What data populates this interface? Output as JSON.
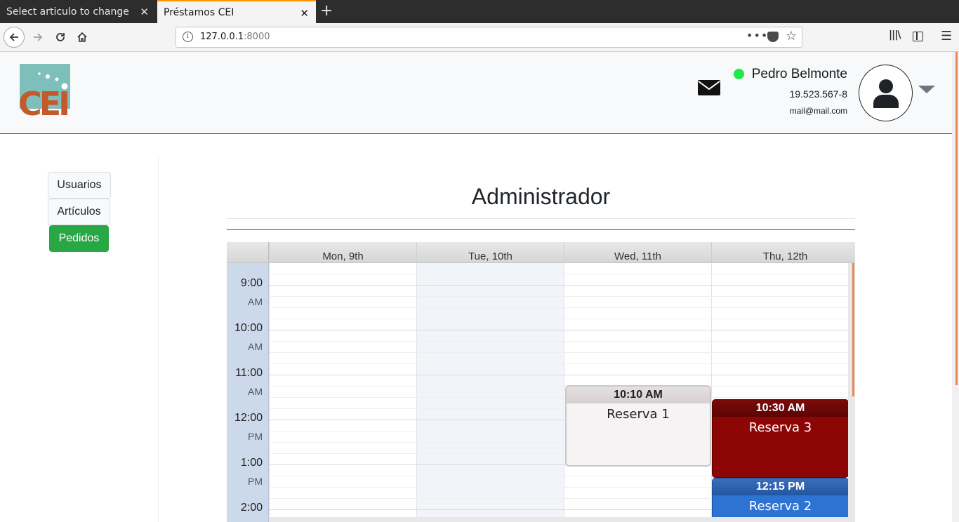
{
  "browser": {
    "tabs": [
      {
        "title": "Select articulo to change | D"
      },
      {
        "title": "Préstamos CEI"
      }
    ],
    "url_host": "127.0.0.1",
    "url_port": ":8000"
  },
  "header": {
    "logo_text": "CEI",
    "user": {
      "name": "Pedro Belmonte",
      "rut": "19.523.567-8",
      "email": "mail@mail.com",
      "status_color": "#1ee84a"
    }
  },
  "sidebar": {
    "items": [
      {
        "label": "Usuarios",
        "active": false
      },
      {
        "label": "Artículos",
        "active": false
      },
      {
        "label": "Pedidos",
        "active": true
      }
    ]
  },
  "main": {
    "title": "Administrador"
  },
  "calendar": {
    "days": [
      "Mon, 9th",
      "Tue, 10th",
      "Wed, 11th",
      "Thu, 12th"
    ],
    "today": "Tue, 10th",
    "hours": [
      {
        "hour": "9:00",
        "ampm": "AM"
      },
      {
        "hour": "10:00",
        "ampm": "AM"
      },
      {
        "hour": "11:00",
        "ampm": "AM"
      },
      {
        "hour": "12:00",
        "ampm": "PM"
      },
      {
        "hour": "1:00",
        "ampm": "PM"
      },
      {
        "hour": "2:00",
        "ampm": ""
      }
    ],
    "events": [
      {
        "time": "10:10 AM",
        "title": "Reserva 1",
        "day": "Wed, 11th",
        "color": "#f5f3f3"
      },
      {
        "time": "10:30 AM",
        "title": "Reserva 3",
        "day": "Thu, 12th",
        "color": "#8c0606"
      },
      {
        "time": "12:15 PM",
        "title": "Reserva 2",
        "day": "Thu, 12th",
        "color": "#2f73d2"
      }
    ]
  },
  "colors": {
    "accent_green": "#28a745",
    "calendar_gutter": "#ccd9ea",
    "today_column": "#f1f4f9"
  }
}
